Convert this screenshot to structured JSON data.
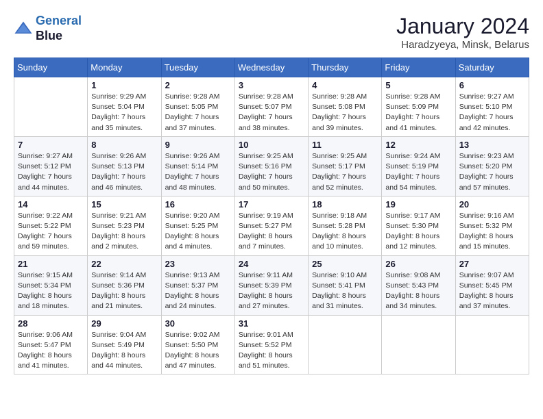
{
  "logo": {
    "line1": "General",
    "line2": "Blue"
  },
  "title": "January 2024",
  "subtitle": "Haradzyeya, Minsk, Belarus",
  "days_header": [
    "Sunday",
    "Monday",
    "Tuesday",
    "Wednesday",
    "Thursday",
    "Friday",
    "Saturday"
  ],
  "weeks": [
    [
      {
        "day": "",
        "sunrise": "",
        "sunset": "",
        "daylight": ""
      },
      {
        "day": "1",
        "sunrise": "Sunrise: 9:29 AM",
        "sunset": "Sunset: 5:04 PM",
        "daylight": "Daylight: 7 hours and 35 minutes."
      },
      {
        "day": "2",
        "sunrise": "Sunrise: 9:28 AM",
        "sunset": "Sunset: 5:05 PM",
        "daylight": "Daylight: 7 hours and 37 minutes."
      },
      {
        "day": "3",
        "sunrise": "Sunrise: 9:28 AM",
        "sunset": "Sunset: 5:07 PM",
        "daylight": "Daylight: 7 hours and 38 minutes."
      },
      {
        "day": "4",
        "sunrise": "Sunrise: 9:28 AM",
        "sunset": "Sunset: 5:08 PM",
        "daylight": "Daylight: 7 hours and 39 minutes."
      },
      {
        "day": "5",
        "sunrise": "Sunrise: 9:28 AM",
        "sunset": "Sunset: 5:09 PM",
        "daylight": "Daylight: 7 hours and 41 minutes."
      },
      {
        "day": "6",
        "sunrise": "Sunrise: 9:27 AM",
        "sunset": "Sunset: 5:10 PM",
        "daylight": "Daylight: 7 hours and 42 minutes."
      }
    ],
    [
      {
        "day": "7",
        "sunrise": "Sunrise: 9:27 AM",
        "sunset": "Sunset: 5:12 PM",
        "daylight": "Daylight: 7 hours and 44 minutes."
      },
      {
        "day": "8",
        "sunrise": "Sunrise: 9:26 AM",
        "sunset": "Sunset: 5:13 PM",
        "daylight": "Daylight: 7 hours and 46 minutes."
      },
      {
        "day": "9",
        "sunrise": "Sunrise: 9:26 AM",
        "sunset": "Sunset: 5:14 PM",
        "daylight": "Daylight: 7 hours and 48 minutes."
      },
      {
        "day": "10",
        "sunrise": "Sunrise: 9:25 AM",
        "sunset": "Sunset: 5:16 PM",
        "daylight": "Daylight: 7 hours and 50 minutes."
      },
      {
        "day": "11",
        "sunrise": "Sunrise: 9:25 AM",
        "sunset": "Sunset: 5:17 PM",
        "daylight": "Daylight: 7 hours and 52 minutes."
      },
      {
        "day": "12",
        "sunrise": "Sunrise: 9:24 AM",
        "sunset": "Sunset: 5:19 PM",
        "daylight": "Daylight: 7 hours and 54 minutes."
      },
      {
        "day": "13",
        "sunrise": "Sunrise: 9:23 AM",
        "sunset": "Sunset: 5:20 PM",
        "daylight": "Daylight: 7 hours and 57 minutes."
      }
    ],
    [
      {
        "day": "14",
        "sunrise": "Sunrise: 9:22 AM",
        "sunset": "Sunset: 5:22 PM",
        "daylight": "Daylight: 7 hours and 59 minutes."
      },
      {
        "day": "15",
        "sunrise": "Sunrise: 9:21 AM",
        "sunset": "Sunset: 5:23 PM",
        "daylight": "Daylight: 8 hours and 2 minutes."
      },
      {
        "day": "16",
        "sunrise": "Sunrise: 9:20 AM",
        "sunset": "Sunset: 5:25 PM",
        "daylight": "Daylight: 8 hours and 4 minutes."
      },
      {
        "day": "17",
        "sunrise": "Sunrise: 9:19 AM",
        "sunset": "Sunset: 5:27 PM",
        "daylight": "Daylight: 8 hours and 7 minutes."
      },
      {
        "day": "18",
        "sunrise": "Sunrise: 9:18 AM",
        "sunset": "Sunset: 5:28 PM",
        "daylight": "Daylight: 8 hours and 10 minutes."
      },
      {
        "day": "19",
        "sunrise": "Sunrise: 9:17 AM",
        "sunset": "Sunset: 5:30 PM",
        "daylight": "Daylight: 8 hours and 12 minutes."
      },
      {
        "day": "20",
        "sunrise": "Sunrise: 9:16 AM",
        "sunset": "Sunset: 5:32 PM",
        "daylight": "Daylight: 8 hours and 15 minutes."
      }
    ],
    [
      {
        "day": "21",
        "sunrise": "Sunrise: 9:15 AM",
        "sunset": "Sunset: 5:34 PM",
        "daylight": "Daylight: 8 hours and 18 minutes."
      },
      {
        "day": "22",
        "sunrise": "Sunrise: 9:14 AM",
        "sunset": "Sunset: 5:36 PM",
        "daylight": "Daylight: 8 hours and 21 minutes."
      },
      {
        "day": "23",
        "sunrise": "Sunrise: 9:13 AM",
        "sunset": "Sunset: 5:37 PM",
        "daylight": "Daylight: 8 hours and 24 minutes."
      },
      {
        "day": "24",
        "sunrise": "Sunrise: 9:11 AM",
        "sunset": "Sunset: 5:39 PM",
        "daylight": "Daylight: 8 hours and 27 minutes."
      },
      {
        "day": "25",
        "sunrise": "Sunrise: 9:10 AM",
        "sunset": "Sunset: 5:41 PM",
        "daylight": "Daylight: 8 hours and 31 minutes."
      },
      {
        "day": "26",
        "sunrise": "Sunrise: 9:08 AM",
        "sunset": "Sunset: 5:43 PM",
        "daylight": "Daylight: 8 hours and 34 minutes."
      },
      {
        "day": "27",
        "sunrise": "Sunrise: 9:07 AM",
        "sunset": "Sunset: 5:45 PM",
        "daylight": "Daylight: 8 hours and 37 minutes."
      }
    ],
    [
      {
        "day": "28",
        "sunrise": "Sunrise: 9:06 AM",
        "sunset": "Sunset: 5:47 PM",
        "daylight": "Daylight: 8 hours and 41 minutes."
      },
      {
        "day": "29",
        "sunrise": "Sunrise: 9:04 AM",
        "sunset": "Sunset: 5:49 PM",
        "daylight": "Daylight: 8 hours and 44 minutes."
      },
      {
        "day": "30",
        "sunrise": "Sunrise: 9:02 AM",
        "sunset": "Sunset: 5:50 PM",
        "daylight": "Daylight: 8 hours and 47 minutes."
      },
      {
        "day": "31",
        "sunrise": "Sunrise: 9:01 AM",
        "sunset": "Sunset: 5:52 PM",
        "daylight": "Daylight: 8 hours and 51 minutes."
      },
      {
        "day": "",
        "sunrise": "",
        "sunset": "",
        "daylight": ""
      },
      {
        "day": "",
        "sunrise": "",
        "sunset": "",
        "daylight": ""
      },
      {
        "day": "",
        "sunrise": "",
        "sunset": "",
        "daylight": ""
      }
    ]
  ]
}
